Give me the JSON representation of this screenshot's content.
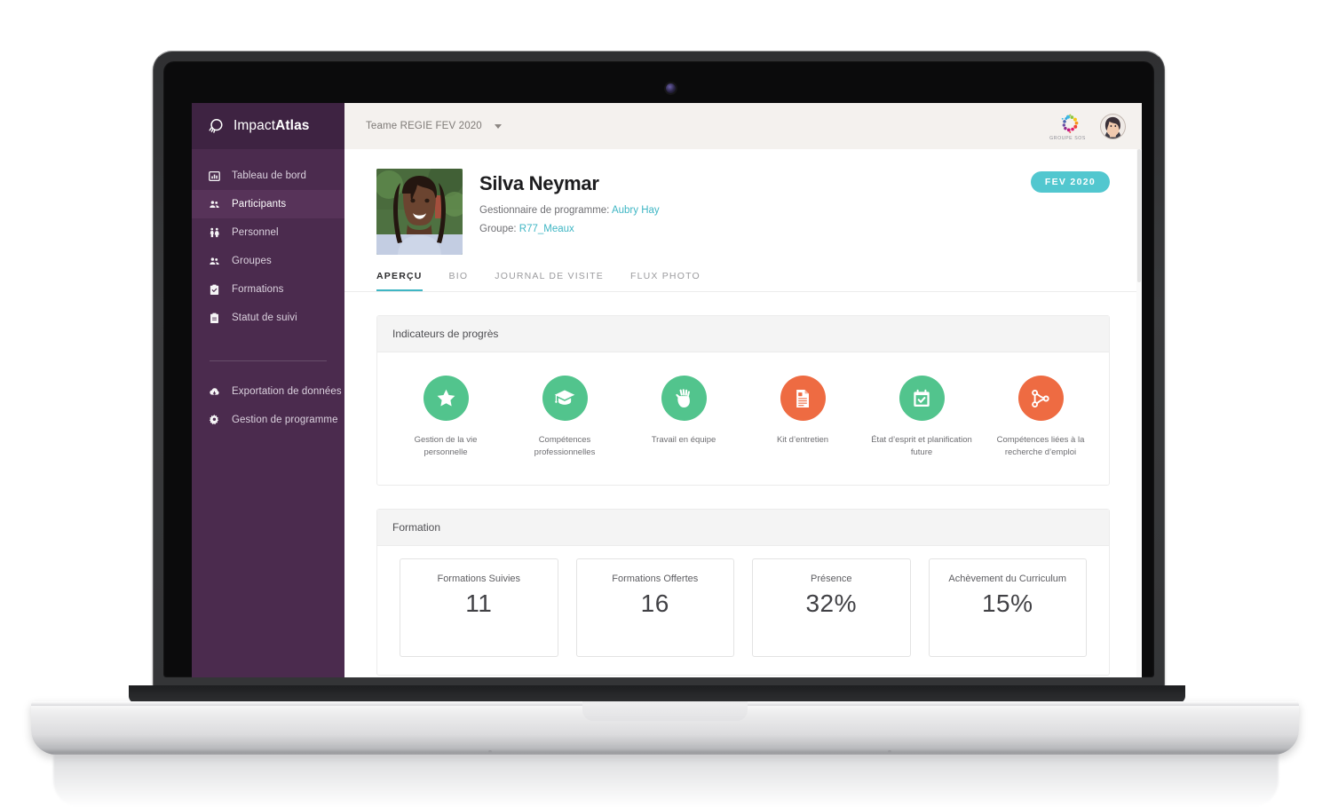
{
  "app": {
    "brand_prefix": "Impact",
    "brand_suffix": "Atlas",
    "brand_full": "ImpactAtlas"
  },
  "sidebar": {
    "items": [
      {
        "label": "Tableau de bord",
        "icon": "bar-chart-icon",
        "active": false
      },
      {
        "label": "Participants",
        "icon": "people-icon",
        "active": true
      },
      {
        "label": "Personnel",
        "icon": "staff-icon",
        "active": false
      },
      {
        "label": "Groupes",
        "icon": "people-icon",
        "active": false
      },
      {
        "label": "Formations",
        "icon": "clipboard-check-icon",
        "active": false
      },
      {
        "label": "Statut de suivi",
        "icon": "clipboard-icon",
        "active": false
      }
    ],
    "footer_items": [
      {
        "label": "Exportation de données",
        "icon": "cloud-download-icon"
      },
      {
        "label": "Gestion de programme",
        "icon": "gear-icon"
      }
    ]
  },
  "topbar": {
    "team_selector_value": "Teame REGIE FEV 2020",
    "org_logo_text": "GROUPE SOS",
    "avatar_alt": "user-avatar"
  },
  "profile": {
    "name": "Silva Neymar",
    "manager_label": "Gestionnaire de programme:",
    "manager_name": "Aubry Hay",
    "group_label": "Groupe:",
    "group_name": "R77_Meaux",
    "period_badge": "FEV 2020",
    "photo_alt": "participant-photo"
  },
  "tabs": [
    {
      "label": "APERÇU",
      "active": true
    },
    {
      "label": "BIO",
      "active": false
    },
    {
      "label": "JOURNAL DE VISITE",
      "active": false
    },
    {
      "label": "FLUX PHOTO",
      "active": false
    }
  ],
  "progress_panel": {
    "title": "Indicateurs de progrès",
    "indicators": [
      {
        "label": "Gestion de la vie personnelle",
        "icon": "star-icon",
        "color": "#52c48d"
      },
      {
        "label": "Compétences professionnelles",
        "icon": "graduation-cap-icon",
        "color": "#52c48d"
      },
      {
        "label": "Travail en équipe",
        "icon": "raised-fist-icon",
        "color": "#52c48d"
      },
      {
        "label": "Kit d’entretien",
        "icon": "document-icon",
        "color": "#ee6b42"
      },
      {
        "label": "État d’esprit et planification future",
        "icon": "calendar-check-icon",
        "color": "#52c48d"
      },
      {
        "label": "Compétences liées à la recherche d’emploi",
        "icon": "git-branch-icon",
        "color": "#ee6b42"
      }
    ]
  },
  "formation_panel": {
    "title": "Formation",
    "stats": [
      {
        "label": "Formations Suivies",
        "value": "11"
      },
      {
        "label": "Formations Offertes",
        "value": "16"
      },
      {
        "label": "Présence",
        "value": "32%"
      },
      {
        "label": "Achèvement du Curriculum",
        "value": "15%"
      }
    ]
  },
  "colors": {
    "sidebar": "#4b2b4e",
    "sidebar_brand": "#3e2342",
    "sidebar_active": "#573359",
    "accent_teal": "#3fb6c4",
    "badge_teal": "#52c7cf",
    "green": "#52c48d",
    "orange": "#ee6b42",
    "topbar": "#f4f1ee"
  }
}
